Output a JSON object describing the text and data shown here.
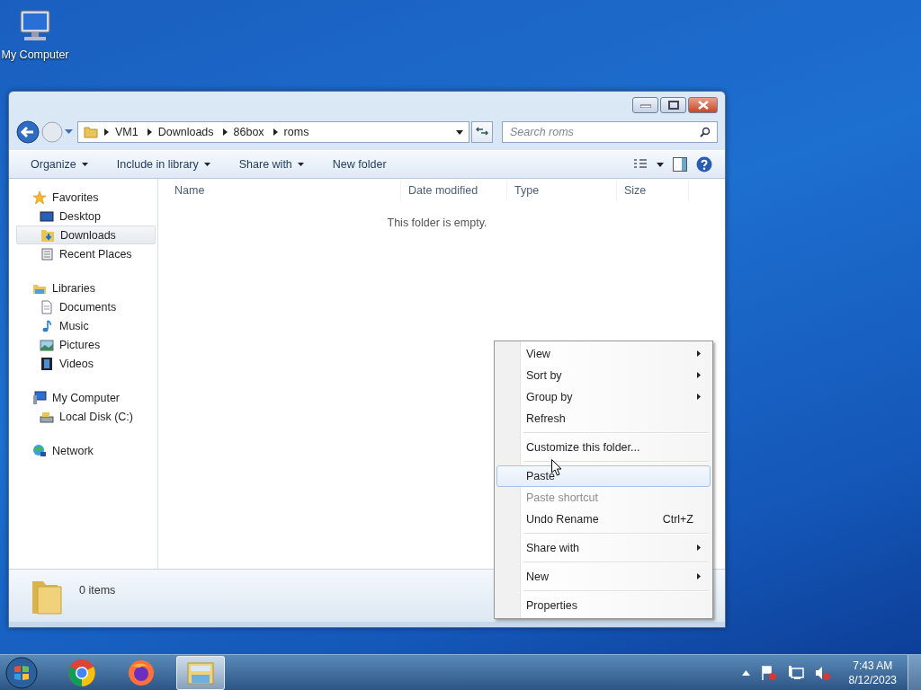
{
  "desktop_icons": [
    {
      "label": "My Computer"
    }
  ],
  "window": {
    "breadcrumb": [
      "VM1",
      "Downloads",
      "86box",
      "roms"
    ],
    "search": {
      "placeholder": "Search roms"
    },
    "toolbar": [
      {
        "label": "Organize",
        "dropdown": true
      },
      {
        "label": "Include in library",
        "dropdown": true
      },
      {
        "label": "Share with",
        "dropdown": true
      },
      {
        "label": "New folder",
        "dropdown": false
      }
    ],
    "sidebar": [
      {
        "label": "Favorites",
        "items": [
          {
            "label": "Desktop",
            "selected": false
          },
          {
            "label": "Downloads",
            "selected": true
          },
          {
            "label": "Recent Places",
            "selected": false
          }
        ]
      },
      {
        "label": "Libraries",
        "items": [
          {
            "label": "Documents",
            "selected": false
          },
          {
            "label": "Music",
            "selected": false
          },
          {
            "label": "Pictures",
            "selected": false
          },
          {
            "label": "Videos",
            "selected": false
          }
        ]
      },
      {
        "label": "My Computer",
        "items": [
          {
            "label": "Local Disk (C:)",
            "selected": false
          }
        ]
      },
      {
        "label": "Network"
      }
    ],
    "columns": [
      "Name",
      "Date modified",
      "Type",
      "Size"
    ],
    "empty_message": "This folder is empty.",
    "status": "0 items"
  },
  "context_menu": [
    [
      {
        "label": "View",
        "submenu": true,
        "disabled": false,
        "selected": false
      },
      {
        "label": "Sort by",
        "submenu": true,
        "disabled": false,
        "selected": false
      },
      {
        "label": "Group by",
        "submenu": true,
        "disabled": false,
        "selected": false
      },
      {
        "label": "Refresh",
        "submenu": false,
        "disabled": false,
        "selected": false
      }
    ],
    [
      {
        "label": "Customize this folder...",
        "submenu": false,
        "disabled": false,
        "selected": false
      }
    ],
    [
      {
        "label": "Paste",
        "submenu": false,
        "disabled": false,
        "selected": true
      },
      {
        "label": "Paste shortcut",
        "submenu": false,
        "disabled": true,
        "selected": false
      },
      {
        "label": "Undo Rename",
        "shortcut": "Ctrl+Z",
        "submenu": false,
        "disabled": false,
        "selected": false
      }
    ],
    [
      {
        "label": "Share with",
        "submenu": true,
        "disabled": false,
        "selected": false
      }
    ],
    [
      {
        "label": "New",
        "submenu": true,
        "disabled": false,
        "selected": false
      }
    ],
    [
      {
        "label": "Properties",
        "submenu": false,
        "disabled": false,
        "selected": false
      }
    ]
  ],
  "taskbar": {
    "apps": [
      {
        "selected": false
      },
      {
        "selected": false
      },
      {
        "selected": true
      }
    ],
    "time": "7:43 AM",
    "date": "8/12/2023"
  }
}
